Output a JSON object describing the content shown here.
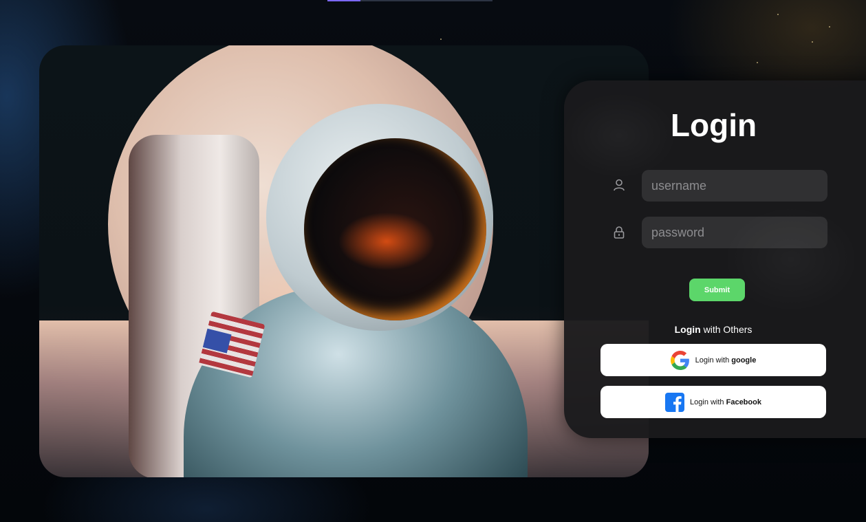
{
  "login": {
    "title": "Login",
    "username_placeholder": "username",
    "password_placeholder": "password",
    "submit_label": "Submit",
    "others_bold": "Login",
    "others_rest": " with Others",
    "google": {
      "prefix": "Login with ",
      "provider": "google"
    },
    "facebook": {
      "prefix": "Login with ",
      "provider": "Facebook"
    }
  },
  "icons": {
    "username": "user-icon",
    "password": "lock-icon",
    "google": "google-logo-icon",
    "facebook": "facebook-logo-icon"
  },
  "colors": {
    "submit": "#5cd66a",
    "panel": "#1a1a1c",
    "google_blue": "#4285F4",
    "google_red": "#EA4335",
    "google_yellow": "#FBBC05",
    "google_green": "#34A853",
    "facebook_blue": "#1877F2"
  }
}
